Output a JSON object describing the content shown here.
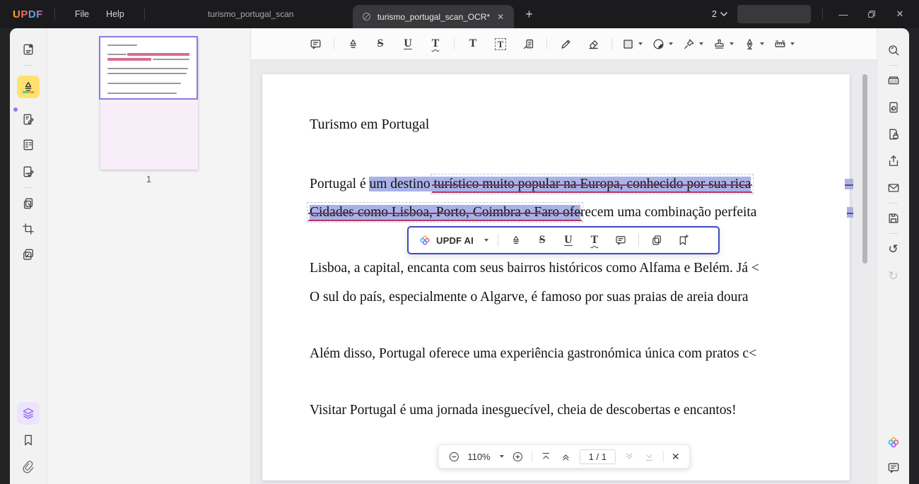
{
  "titlebar": {
    "logo": "UPDF",
    "menus": {
      "file": "File",
      "help": "Help"
    },
    "tabs": {
      "inactive": "turismo_portugal_scan",
      "active": "turismo_portugal_scan_OCR*"
    },
    "tab_count": "2",
    "new_tab": "+",
    "close_tab": "✕",
    "minimize": "—",
    "close": "✕"
  },
  "toolbar": {
    "strikethrough_glyph": "S",
    "underline_glyph": "U",
    "squiggly_glyph": "T",
    "text_glyph": "T",
    "textbox_glyph": "T"
  },
  "right_sidebar": {
    "ocr_label": "OCR"
  },
  "thumbnail_panel": {
    "page_number": "1"
  },
  "document": {
    "title": "Turismo em Portugal",
    "p1_l1_s1": "Portugal é ",
    "p1_l1_s2": "um destino ",
    "p1_l1_s3": "turístico muito popular na Europa, conhecido por sua rica",
    "p1_l2_s1": "Cidades como Lisboa, Porto, Coimbra e Faro ofe",
    "p1_l2_s2": "recem uma combinação perfeita",
    "p2_l1": "Lisboa, a capital, encanta com seus bairros históricos como Alfama e Belém. Já <",
    "p2_l2": "O sul do país, especialmente o Algarve, é famoso por suas praias de areia doura",
    "p3": "Além disso, Portugal oferece uma experiência gastronómica única com pratos c<",
    "p4": "Visitar Portugal é uma jornada inesguecível, cheia de descobertas e encantos!"
  },
  "floating_toolbar": {
    "ai_label": "UPDF AI",
    "strikethrough_glyph": "S",
    "underline_glyph": "U",
    "squiggly_glyph": "T"
  },
  "bottom_bar": {
    "zoom_level": "110%",
    "page_indicator": "1 / 1",
    "close": "✕"
  },
  "colors": {
    "accent_blue": "#3b4cc0",
    "selection_highlight": "#a9b2e8",
    "strike_red": "#8f3560",
    "underline_red": "#b5345c",
    "active_tool_yellow": "#ffe26e",
    "accent_purple": "#8b5cf6"
  }
}
